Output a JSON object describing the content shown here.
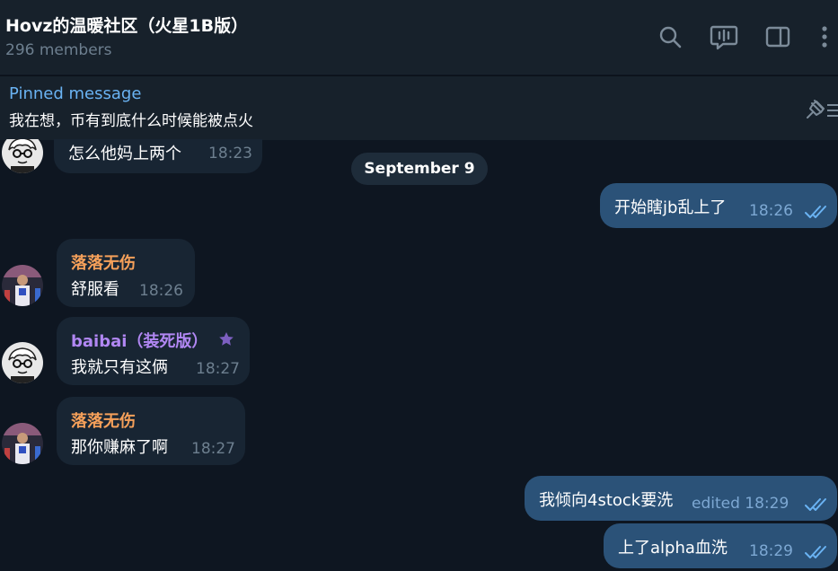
{
  "header": {
    "title": "Hovz的温暖社区（火星1B版）",
    "subtitle": "296 members",
    "icons": [
      "search-icon",
      "voice-chat-icon",
      "sidebar-toggle-icon",
      "more-menu-icon"
    ]
  },
  "pinned": {
    "label": "Pinned message",
    "text": "我在想，币有到底什么时候能被点火",
    "icon": "pinned-list-icon"
  },
  "date_separator": "September 9",
  "messages": [
    {
      "text": "怎么他妈上两个",
      "time": "18:23",
      "outgoing": false
    },
    {
      "text": "开始瞎jb乱上了",
      "time": "18:26",
      "outgoing": true,
      "read": true
    },
    {
      "sender": "落落无伤",
      "sender_color": "#f5a05a",
      "text": "舒服看",
      "time": "18:26",
      "outgoing": false
    },
    {
      "sender": "baibai（装死版）",
      "sender_color": "#b187f3",
      "text": "我就只有这俩",
      "time": "18:27",
      "outgoing": false,
      "badge": "star-icon"
    },
    {
      "sender": "落落无伤",
      "sender_color": "#f5a05a",
      "text": "那你赚麻了啊",
      "time": "18:27",
      "outgoing": false
    },
    {
      "text": "我倾向4stock要洗",
      "time": "edited 18:29",
      "outgoing": true,
      "read": true
    },
    {
      "text": "上了alpha血洗",
      "time": "18:29",
      "outgoing": true,
      "read": true
    }
  ],
  "colors": {
    "background": "#0e1621",
    "header": "#17212b",
    "incoming_bubble": "#182533",
    "outgoing_bubble": "#2b5278",
    "accent": "#6ab3f3"
  }
}
